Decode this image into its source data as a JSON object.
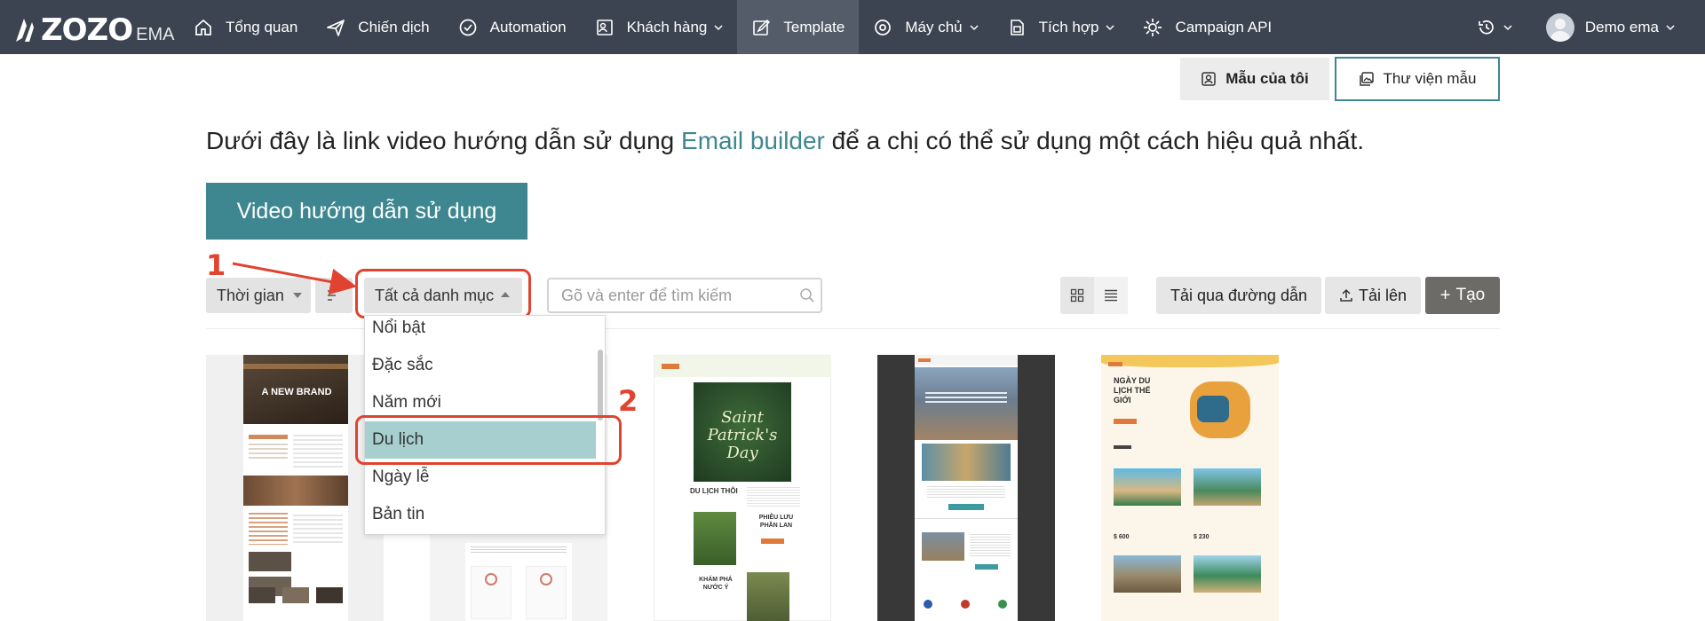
{
  "nav": {
    "logo_text": "ZOZO",
    "logo_sub": "EMA",
    "items": [
      {
        "label": "Tổng quan",
        "icon": "home-icon"
      },
      {
        "label": "Chiến dịch",
        "icon": "send-icon"
      },
      {
        "label": "Automation",
        "icon": "automation-check-icon"
      },
      {
        "label": "Khách hàng",
        "icon": "customers-icon",
        "dropdown": true
      },
      {
        "label": "Template",
        "icon": "template-edit-icon",
        "active": true
      },
      {
        "label": "Máy chủ",
        "icon": "server-icon",
        "dropdown": true
      },
      {
        "label": "Tích hợp",
        "icon": "integration-icon",
        "dropdown": true
      },
      {
        "label": "Campaign API",
        "icon": "api-gear-icon"
      }
    ],
    "user_name": "Demo ema"
  },
  "tabs": {
    "mine_label": "Mẫu của tôi",
    "library_label": "Thư viện mẫu",
    "active": "Thư viện mẫu"
  },
  "intro": {
    "before": "Dưới đây là link video hướng dẫn sử dụng ",
    "link": "Email builder",
    "after": " để a chị có thể sử dụng một cách hiệu quả nhất."
  },
  "video_button": "Video hướng dẫn sử dụng",
  "toolbar": {
    "time_select": "Thời gian",
    "category_select": "Tất cả danh mục",
    "search_placeholder": "Gõ và enter để tìm kiếm",
    "url_button": "Tải qua đường dẫn",
    "upload_button": "Tải lên",
    "create_button": "Tạo"
  },
  "category_options": [
    "Nổi bật",
    "Đặc sắc",
    "Năm mới",
    "Du lịch",
    "Ngày lễ",
    "Bản tin"
  ],
  "selected_option": "Du lịch",
  "annotations": [
    "1",
    "2"
  ],
  "cards": [
    {
      "text_a": "A NEW BRAND"
    },
    {
      "text_a": ""
    },
    {
      "text_a": "Saint Patrick's Day",
      "text_b": "DU LỊCH THÔI",
      "text_c": "PHIÊU LƯU PHẦN LAN",
      "text_d": "KHÁM PHÁ NƯỚC Ý"
    },
    {
      "text_a": ""
    },
    {
      "text_a": "NGÀY DU LỊCH THẾ GIỚI",
      "price_a": "$ 600",
      "price_b": "$ 230"
    }
  ],
  "colors": {
    "nav_bg": "#3d4451",
    "accent": "#3e8791",
    "annotation": "#e0432f",
    "selected": "#a7cfcf"
  }
}
